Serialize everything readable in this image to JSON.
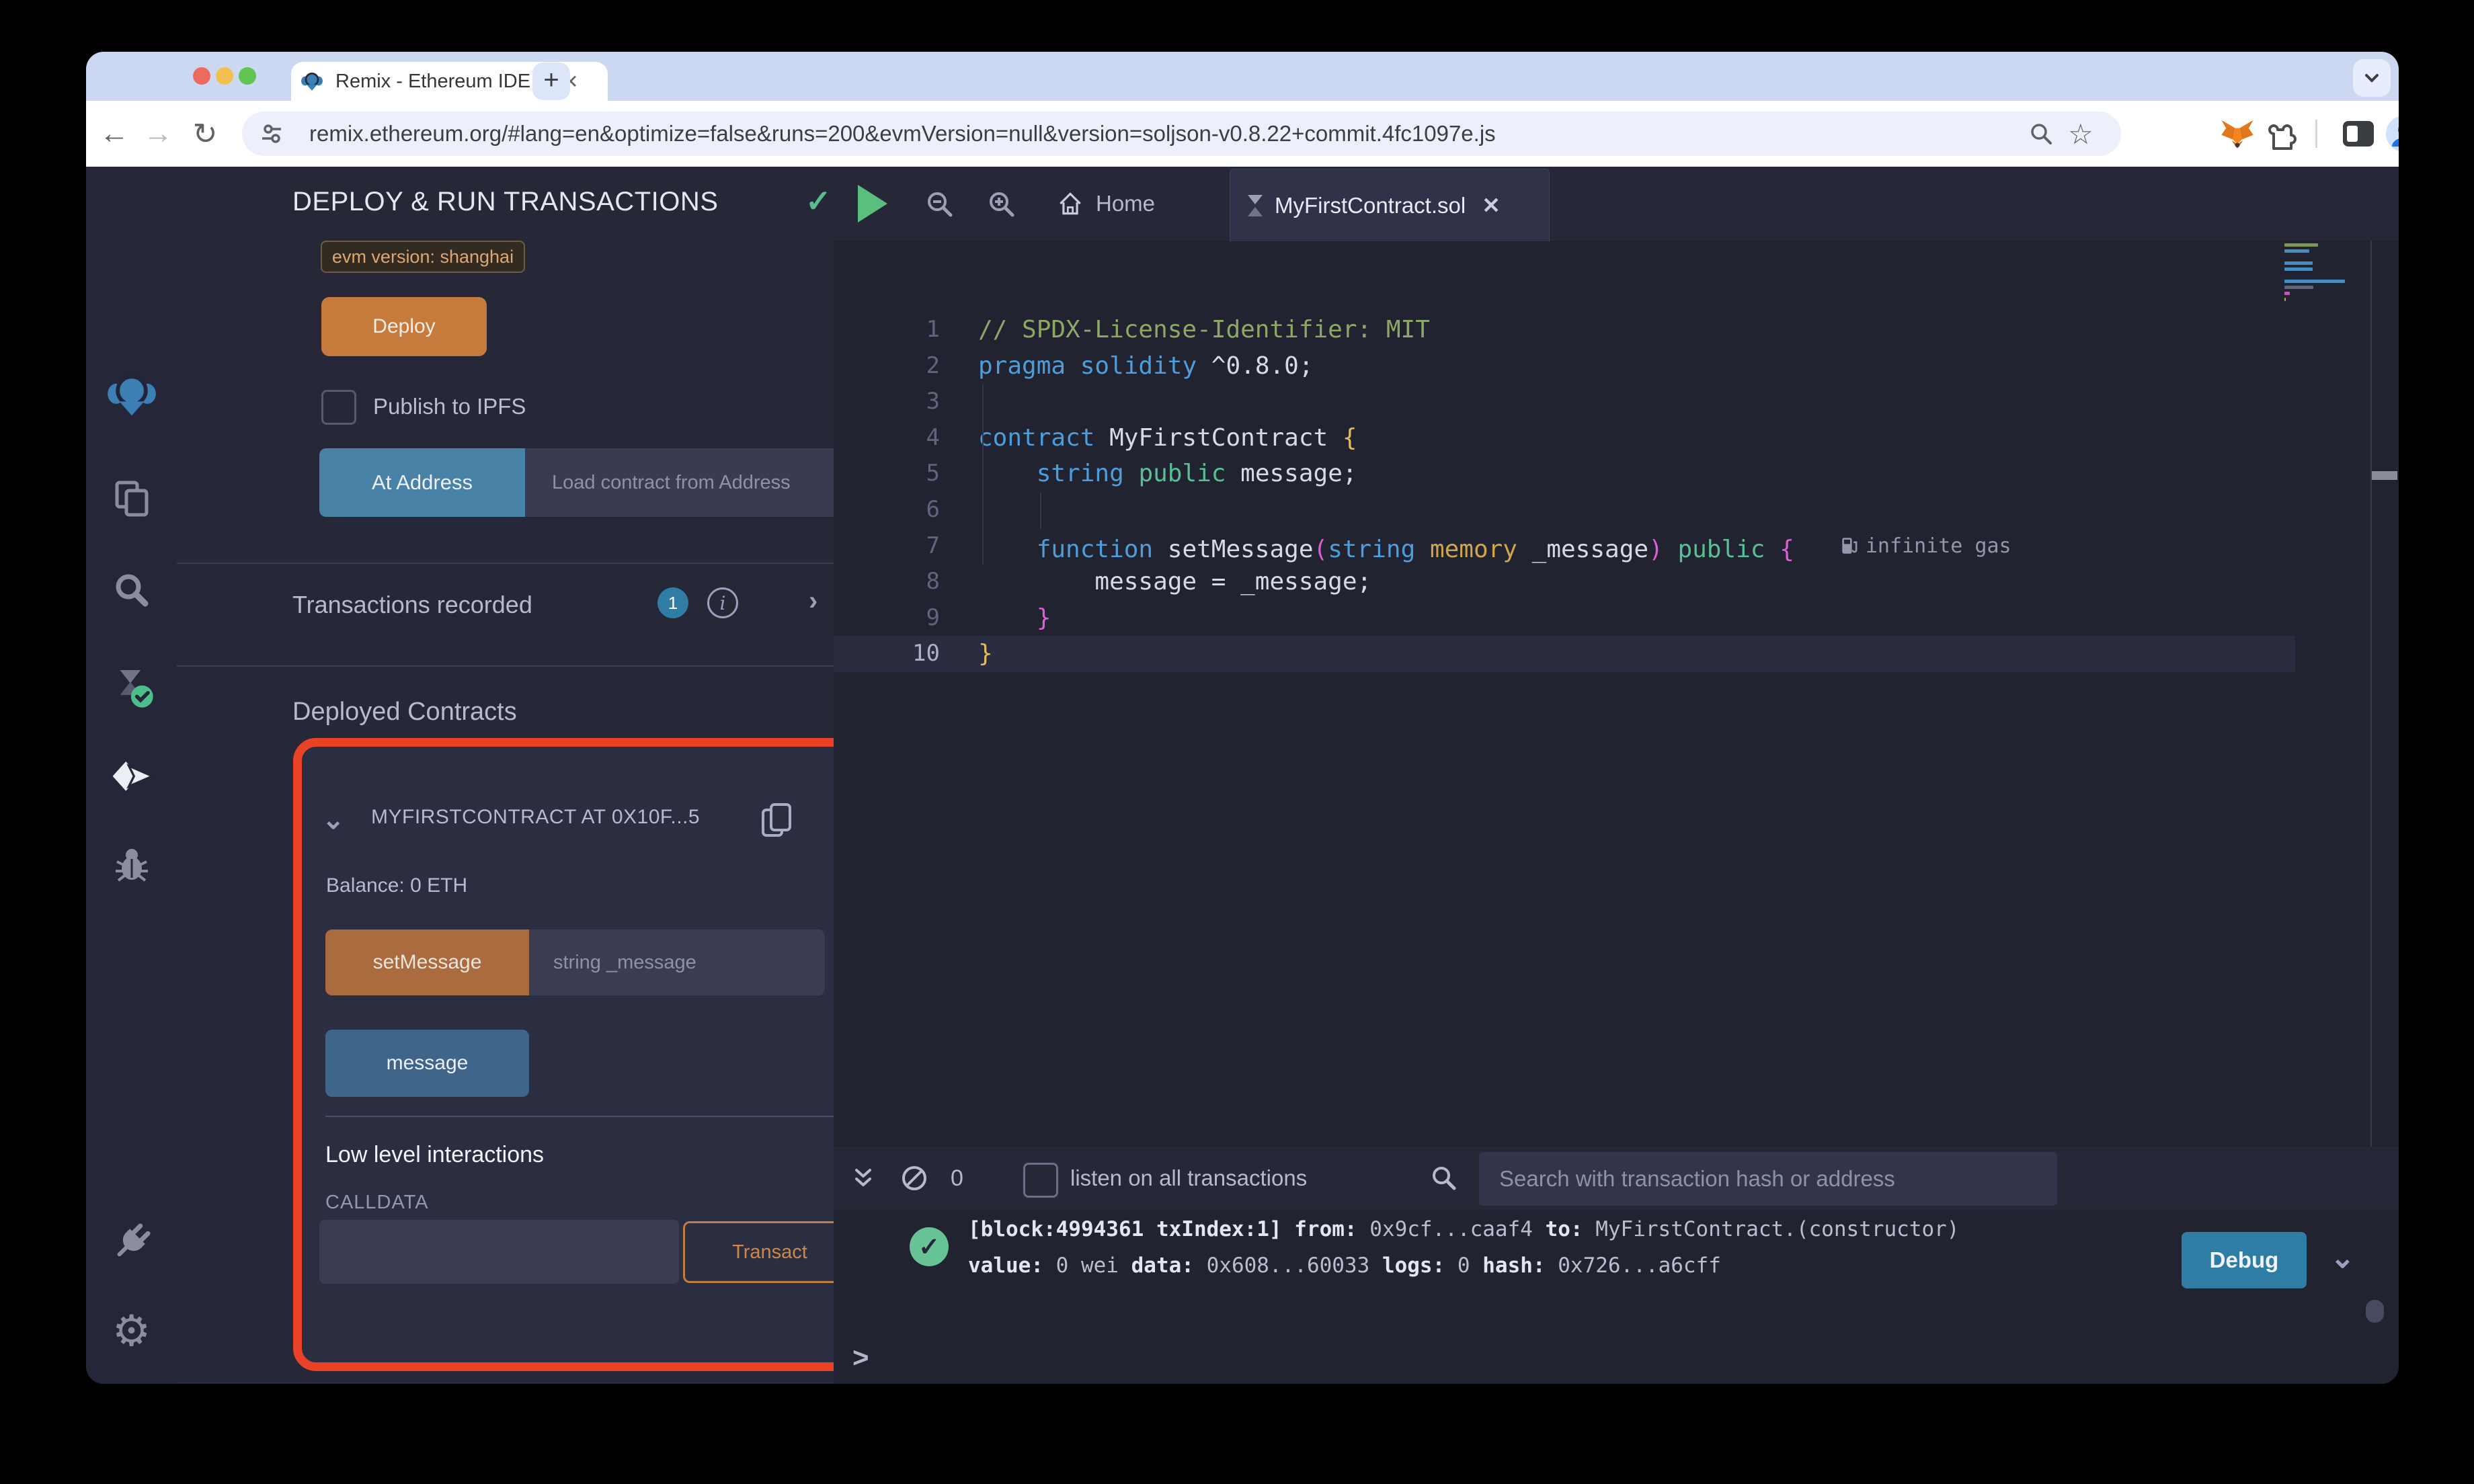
{
  "browser": {
    "tab_title": "Remix - Ethereum IDE",
    "close_tab": "✕",
    "new_tab": "+",
    "url": "remix.ethereum.org/#lang=en&optimize=false&runs=200&evmVersion=null&version=soljson-v0.8.22+commit.4fc1097e.js",
    "back": "←",
    "forward": "→",
    "reload": "↻",
    "star": "☆",
    "kebab": "⋮"
  },
  "activity_bar": {
    "items": [
      "remix-logo",
      "file-explorer",
      "search",
      "solidity-compiler",
      "deploy-and-run",
      "debugger",
      "plugin-manager",
      "settings"
    ],
    "settings_glyph": "⚙"
  },
  "run_panel": {
    "title": "DEPLOY & RUN TRANSACTIONS",
    "title_check": "✓",
    "chevron": "›",
    "evm_badge": "evm version: shanghai",
    "deploy_label": "Deploy",
    "publish_label": "Publish to IPFS",
    "at_address_label": "At Address",
    "at_address_placeholder": "Load contract from Address",
    "transactions_recorded_label": "Transactions recorded",
    "transactions_count": "1",
    "info_glyph": "i",
    "deployed_contracts_label": "Deployed Contracts",
    "contract": {
      "header": "MYFIRSTCONTRACT AT 0X10F...5",
      "collapse_chevron": "⌄",
      "close": "✕",
      "balance": "Balance: 0 ETH",
      "set_message_label": "setMessage",
      "set_message_placeholder": "string _message",
      "expand_chevron": "⌄",
      "message_label": "message",
      "low_level_label": "Low level interactions",
      "low_level_info": "i",
      "calldata_label": "CALLDATA",
      "transact_label": "Transact"
    }
  },
  "editor": {
    "home_tab": "Home",
    "file_tab": "MyFirstContract.sol",
    "file_tab_close": "✕",
    "gas_annotation": "infinite gas",
    "code": {
      "language": "solidity",
      "active_line": 10,
      "lines": [
        {
          "n": "1",
          "tokens": [
            [
              "c",
              "// SPDX-License-Identifier: MIT"
            ]
          ]
        },
        {
          "n": "2",
          "tokens": [
            [
              "k",
              "pragma"
            ],
            [
              "p",
              " "
            ],
            [
              "k",
              "solidity"
            ],
            [
              "p",
              " ^0.8.0;"
            ]
          ]
        },
        {
          "n": "3",
          "tokens": []
        },
        {
          "n": "4",
          "tokens": [
            [
              "k",
              "contract"
            ],
            [
              "p",
              " MyFirstContract "
            ],
            [
              "y",
              "{"
            ]
          ]
        },
        {
          "n": "5",
          "tokens": [
            [
              "p",
              "    "
            ],
            [
              "k",
              "string"
            ],
            [
              "p",
              " "
            ],
            [
              "g",
              "public"
            ],
            [
              "p",
              " message;"
            ]
          ]
        },
        {
          "n": "6",
          "tokens": []
        },
        {
          "n": "7",
          "tokens": [
            [
              "k",
              "function"
            ],
            [
              "p",
              " setMessage"
            ],
            [
              "m",
              "("
            ],
            [
              "k",
              "string"
            ],
            [
              "p",
              " "
            ],
            [
              "o",
              "memory"
            ],
            [
              "p",
              " _message"
            ],
            [
              "m",
              ")"
            ],
            [
              "p",
              " "
            ],
            [
              "g",
              "public"
            ],
            [
              "p",
              " "
            ],
            [
              "m",
              "{"
            ],
            [
              "gas",
              "infinite gas"
            ]
          ],
          "indent": 1
        },
        {
          "n": "8",
          "tokens": [
            [
              "p",
              "message = _message;"
            ]
          ],
          "indent": 2
        },
        {
          "n": "9",
          "tokens": [
            [
              "m",
              "}"
            ]
          ],
          "indent": 1
        },
        {
          "n": "10",
          "tokens": [
            [
              "y",
              "}"
            ]
          ],
          "active": true
        }
      ]
    }
  },
  "terminal": {
    "count": "0",
    "listen_label": "listen on all transactions",
    "search_placeholder": "Search with transaction hash or address",
    "status": "success",
    "log_line1": [
      [
        "b",
        "[block:4994361 txIndex:1]"
      ],
      [
        "n",
        " "
      ],
      [
        "b",
        "from:"
      ],
      [
        "n",
        " 0x9cf...caaf4 "
      ],
      [
        "b",
        "to:"
      ],
      [
        "n",
        " MyFirstContract.(constructor) "
      ]
    ],
    "log_line2": [
      [
        "b",
        "value:"
      ],
      [
        "n",
        " 0 wei "
      ],
      [
        "b",
        "data:"
      ],
      [
        "n",
        " 0x608...60033 "
      ],
      [
        "b",
        "logs:"
      ],
      [
        "n",
        " 0 "
      ],
      [
        "b",
        "hash:"
      ],
      [
        "n",
        " 0x726...a6cff"
      ]
    ],
    "check_glyph": "✓",
    "debug_label": "Debug",
    "expand_chevron": "⌄",
    "prompt": ">"
  },
  "colors": {
    "deploy_orange": "#C67A3C",
    "set_message_orange": "#AA6C3E",
    "at_address_teal": "#4882A6",
    "message_blue": "#40658B",
    "badge_blue": "#2F7DA4",
    "debug_blue": "#2F7DA4",
    "highlight_red": "#EA4227",
    "success_green": "#67C295",
    "evm_badge_text": "#DCA673",
    "panel_bg": "#262737",
    "editor_bg": "#222331"
  }
}
